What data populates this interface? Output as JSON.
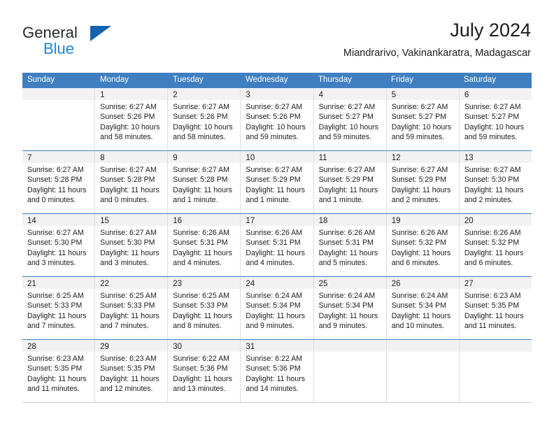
{
  "brand": {
    "name_primary": "General",
    "name_secondary": "Blue",
    "accent_color": "#1263b0",
    "secondary_color": "#1c86d6"
  },
  "header": {
    "title": "July 2024",
    "subtitle": "Miandrarivo, Vakinankaratra, Madagascar"
  },
  "calendar": {
    "header_bg": "#3f7fc1",
    "weekdays": [
      "Sunday",
      "Monday",
      "Tuesday",
      "Wednesday",
      "Thursday",
      "Friday",
      "Saturday"
    ],
    "weeks": [
      [
        {
          "day": "",
          "lines": []
        },
        {
          "day": "1",
          "lines": [
            "Sunrise: 6:27 AM",
            "Sunset: 5:26 PM",
            "Daylight: 10 hours",
            "and 58 minutes."
          ]
        },
        {
          "day": "2",
          "lines": [
            "Sunrise: 6:27 AM",
            "Sunset: 5:26 PM",
            "Daylight: 10 hours",
            "and 58 minutes."
          ]
        },
        {
          "day": "3",
          "lines": [
            "Sunrise: 6:27 AM",
            "Sunset: 5:26 PM",
            "Daylight: 10 hours",
            "and 59 minutes."
          ]
        },
        {
          "day": "4",
          "lines": [
            "Sunrise: 6:27 AM",
            "Sunset: 5:27 PM",
            "Daylight: 10 hours",
            "and 59 minutes."
          ]
        },
        {
          "day": "5",
          "lines": [
            "Sunrise: 6:27 AM",
            "Sunset: 5:27 PM",
            "Daylight: 10 hours",
            "and 59 minutes."
          ]
        },
        {
          "day": "6",
          "lines": [
            "Sunrise: 6:27 AM",
            "Sunset: 5:27 PM",
            "Daylight: 10 hours",
            "and 59 minutes."
          ]
        }
      ],
      [
        {
          "day": "7",
          "lines": [
            "Sunrise: 6:27 AM",
            "Sunset: 5:28 PM",
            "Daylight: 11 hours",
            "and 0 minutes."
          ]
        },
        {
          "day": "8",
          "lines": [
            "Sunrise: 6:27 AM",
            "Sunset: 5:28 PM",
            "Daylight: 11 hours",
            "and 0 minutes."
          ]
        },
        {
          "day": "9",
          "lines": [
            "Sunrise: 6:27 AM",
            "Sunset: 5:28 PM",
            "Daylight: 11 hours",
            "and 1 minute."
          ]
        },
        {
          "day": "10",
          "lines": [
            "Sunrise: 6:27 AM",
            "Sunset: 5:29 PM",
            "Daylight: 11 hours",
            "and 1 minute."
          ]
        },
        {
          "day": "11",
          "lines": [
            "Sunrise: 6:27 AM",
            "Sunset: 5:29 PM",
            "Daylight: 11 hours",
            "and 1 minute."
          ]
        },
        {
          "day": "12",
          "lines": [
            "Sunrise: 6:27 AM",
            "Sunset: 5:29 PM",
            "Daylight: 11 hours",
            "and 2 minutes."
          ]
        },
        {
          "day": "13",
          "lines": [
            "Sunrise: 6:27 AM",
            "Sunset: 5:30 PM",
            "Daylight: 11 hours",
            "and 2 minutes."
          ]
        }
      ],
      [
        {
          "day": "14",
          "lines": [
            "Sunrise: 6:27 AM",
            "Sunset: 5:30 PM",
            "Daylight: 11 hours",
            "and 3 minutes."
          ]
        },
        {
          "day": "15",
          "lines": [
            "Sunrise: 6:27 AM",
            "Sunset: 5:30 PM",
            "Daylight: 11 hours",
            "and 3 minutes."
          ]
        },
        {
          "day": "16",
          "lines": [
            "Sunrise: 6:26 AM",
            "Sunset: 5:31 PM",
            "Daylight: 11 hours",
            "and 4 minutes."
          ]
        },
        {
          "day": "17",
          "lines": [
            "Sunrise: 6:26 AM",
            "Sunset: 5:31 PM",
            "Daylight: 11 hours",
            "and 4 minutes."
          ]
        },
        {
          "day": "18",
          "lines": [
            "Sunrise: 6:26 AM",
            "Sunset: 5:31 PM",
            "Daylight: 11 hours",
            "and 5 minutes."
          ]
        },
        {
          "day": "19",
          "lines": [
            "Sunrise: 6:26 AM",
            "Sunset: 5:32 PM",
            "Daylight: 11 hours",
            "and 6 minutes."
          ]
        },
        {
          "day": "20",
          "lines": [
            "Sunrise: 6:26 AM",
            "Sunset: 5:32 PM",
            "Daylight: 11 hours",
            "and 6 minutes."
          ]
        }
      ],
      [
        {
          "day": "21",
          "lines": [
            "Sunrise: 6:25 AM",
            "Sunset: 5:33 PM",
            "Daylight: 11 hours",
            "and 7 minutes."
          ]
        },
        {
          "day": "22",
          "lines": [
            "Sunrise: 6:25 AM",
            "Sunset: 5:33 PM",
            "Daylight: 11 hours",
            "and 7 minutes."
          ]
        },
        {
          "day": "23",
          "lines": [
            "Sunrise: 6:25 AM",
            "Sunset: 5:33 PM",
            "Daylight: 11 hours",
            "and 8 minutes."
          ]
        },
        {
          "day": "24",
          "lines": [
            "Sunrise: 6:24 AM",
            "Sunset: 5:34 PM",
            "Daylight: 11 hours",
            "and 9 minutes."
          ]
        },
        {
          "day": "25",
          "lines": [
            "Sunrise: 6:24 AM",
            "Sunset: 5:34 PM",
            "Daylight: 11 hours",
            "and 9 minutes."
          ]
        },
        {
          "day": "26",
          "lines": [
            "Sunrise: 6:24 AM",
            "Sunset: 5:34 PM",
            "Daylight: 11 hours",
            "and 10 minutes."
          ]
        },
        {
          "day": "27",
          "lines": [
            "Sunrise: 6:23 AM",
            "Sunset: 5:35 PM",
            "Daylight: 11 hours",
            "and 11 minutes."
          ]
        }
      ],
      [
        {
          "day": "28",
          "lines": [
            "Sunrise: 6:23 AM",
            "Sunset: 5:35 PM",
            "Daylight: 11 hours",
            "and 11 minutes."
          ]
        },
        {
          "day": "29",
          "lines": [
            "Sunrise: 6:23 AM",
            "Sunset: 5:35 PM",
            "Daylight: 11 hours",
            "and 12 minutes."
          ]
        },
        {
          "day": "30",
          "lines": [
            "Sunrise: 6:22 AM",
            "Sunset: 5:36 PM",
            "Daylight: 11 hours",
            "and 13 minutes."
          ]
        },
        {
          "day": "31",
          "lines": [
            "Sunrise: 6:22 AM",
            "Sunset: 5:36 PM",
            "Daylight: 11 hours",
            "and 14 minutes."
          ]
        },
        {
          "day": "",
          "lines": []
        },
        {
          "day": "",
          "lines": []
        },
        {
          "day": "",
          "lines": []
        }
      ]
    ]
  }
}
